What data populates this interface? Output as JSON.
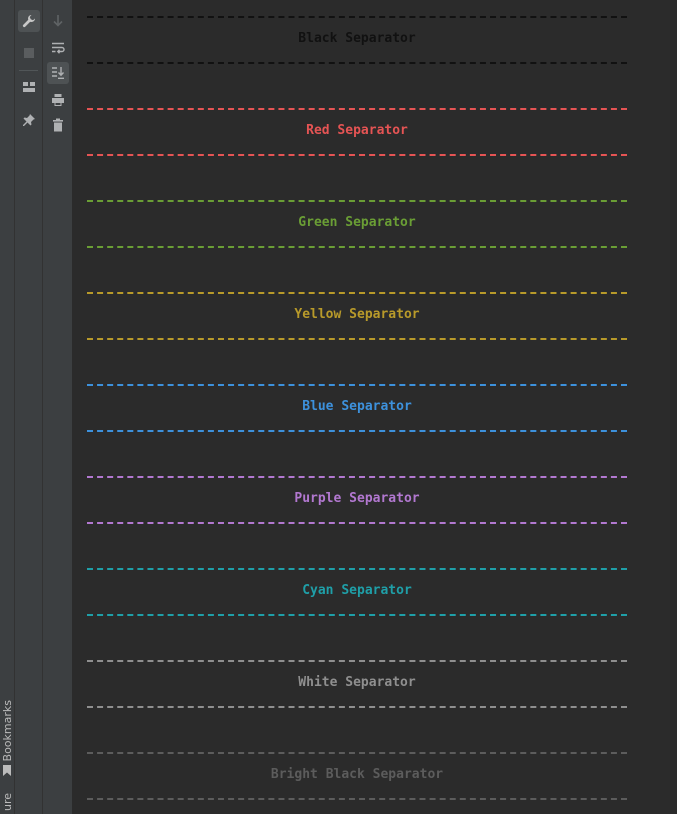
{
  "side_tabs": {
    "bookmarks": "Bookmarks",
    "structure": "ure"
  },
  "icons": {
    "wrench": "wrench-icon",
    "stop": "stop-icon",
    "layout": "layout-icon",
    "pin": "pin-icon",
    "down_arrow": "down-arrow-icon",
    "soft_wrap": "soft-wrap-icon",
    "scroll_to_end": "scroll-to-end-icon",
    "print": "print-icon",
    "trash": "trash-icon",
    "bookmark": "bookmark-icon"
  },
  "separators": [
    {
      "label": "Black Separator",
      "color": "#111111"
    },
    {
      "label": "Red Separator",
      "color": "#e55454"
    },
    {
      "label": "Green Separator",
      "color": "#6a9e35"
    },
    {
      "label": "Yellow Separator",
      "color": "#b89a2a"
    },
    {
      "label": "Blue Separator",
      "color": "#3d91dc"
    },
    {
      "label": "Purple Separator",
      "color": "#b278d0"
    },
    {
      "label": "Cyan Separator",
      "color": "#1f9fa8"
    },
    {
      "label": "White Separator",
      "color": "#8f8f8f"
    },
    {
      "label": "Bright Black Separator",
      "color": "#5c5c5c"
    }
  ]
}
